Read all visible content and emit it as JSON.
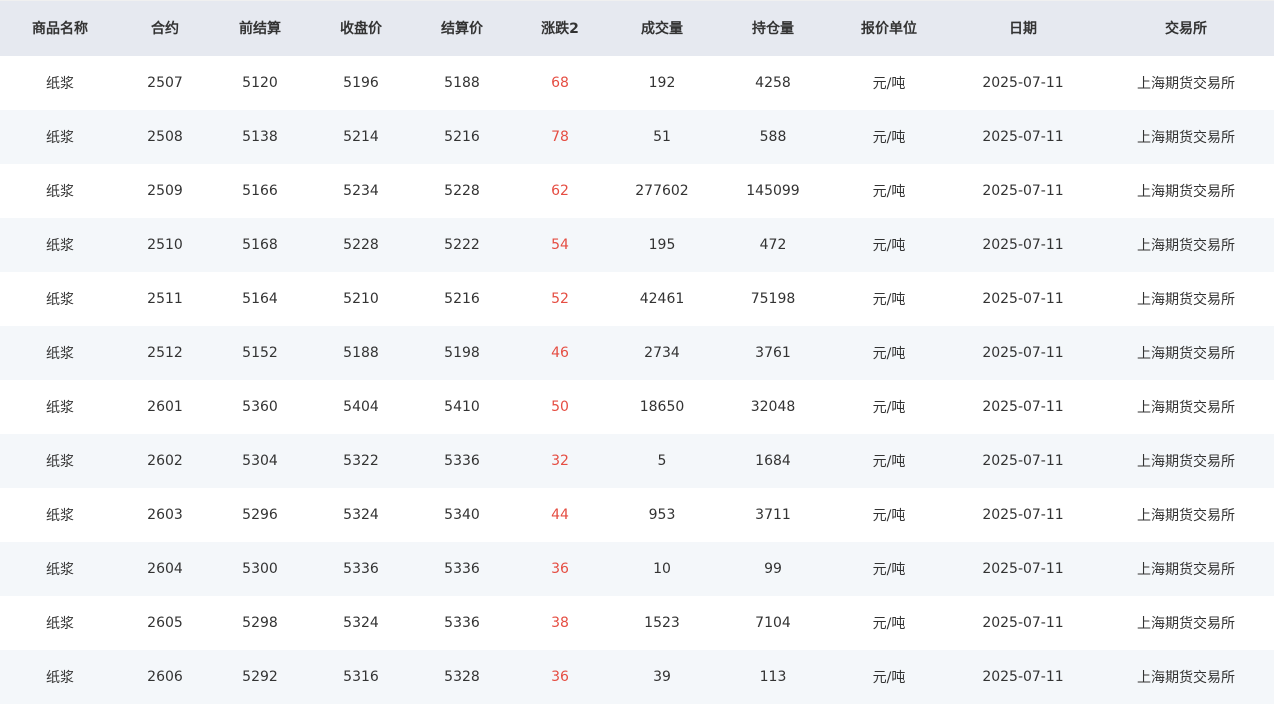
{
  "colors": {
    "header_bg": "#e6e9f0",
    "row_alt_bg": "#f4f7fa",
    "up_color": "#e54d42",
    "text": "#333333"
  },
  "table": {
    "columns": [
      "商品名称",
      "合约",
      "前结算",
      "收盘价",
      "结算价",
      "涨跌2",
      "成交量",
      "持仓量",
      "报价单位",
      "日期",
      "交易所"
    ],
    "rows": [
      [
        "纸浆",
        "2507",
        "5120",
        "5196",
        "5188",
        "68",
        "192",
        "4258",
        "元/吨",
        "2025-07-11",
        "上海期货交易所"
      ],
      [
        "纸浆",
        "2508",
        "5138",
        "5214",
        "5216",
        "78",
        "51",
        "588",
        "元/吨",
        "2025-07-11",
        "上海期货交易所"
      ],
      [
        "纸浆",
        "2509",
        "5166",
        "5234",
        "5228",
        "62",
        "277602",
        "145099",
        "元/吨",
        "2025-07-11",
        "上海期货交易所"
      ],
      [
        "纸浆",
        "2510",
        "5168",
        "5228",
        "5222",
        "54",
        "195",
        "472",
        "元/吨",
        "2025-07-11",
        "上海期货交易所"
      ],
      [
        "纸浆",
        "2511",
        "5164",
        "5210",
        "5216",
        "52",
        "42461",
        "75198",
        "元/吨",
        "2025-07-11",
        "上海期货交易所"
      ],
      [
        "纸浆",
        "2512",
        "5152",
        "5188",
        "5198",
        "46",
        "2734",
        "3761",
        "元/吨",
        "2025-07-11",
        "上海期货交易所"
      ],
      [
        "纸浆",
        "2601",
        "5360",
        "5404",
        "5410",
        "50",
        "18650",
        "32048",
        "元/吨",
        "2025-07-11",
        "上海期货交易所"
      ],
      [
        "纸浆",
        "2602",
        "5304",
        "5322",
        "5336",
        "32",
        "5",
        "1684",
        "元/吨",
        "2025-07-11",
        "上海期货交易所"
      ],
      [
        "纸浆",
        "2603",
        "5296",
        "5324",
        "5340",
        "44",
        "953",
        "3711",
        "元/吨",
        "2025-07-11",
        "上海期货交易所"
      ],
      [
        "纸浆",
        "2604",
        "5300",
        "5336",
        "5336",
        "36",
        "10",
        "99",
        "元/吨",
        "2025-07-11",
        "上海期货交易所"
      ],
      [
        "纸浆",
        "2605",
        "5298",
        "5324",
        "5336",
        "38",
        "1523",
        "7104",
        "元/吨",
        "2025-07-11",
        "上海期货交易所"
      ],
      [
        "纸浆",
        "2606",
        "5292",
        "5316",
        "5328",
        "36",
        "39",
        "113",
        "元/吨",
        "2025-07-11",
        "上海期货交易所"
      ]
    ]
  }
}
